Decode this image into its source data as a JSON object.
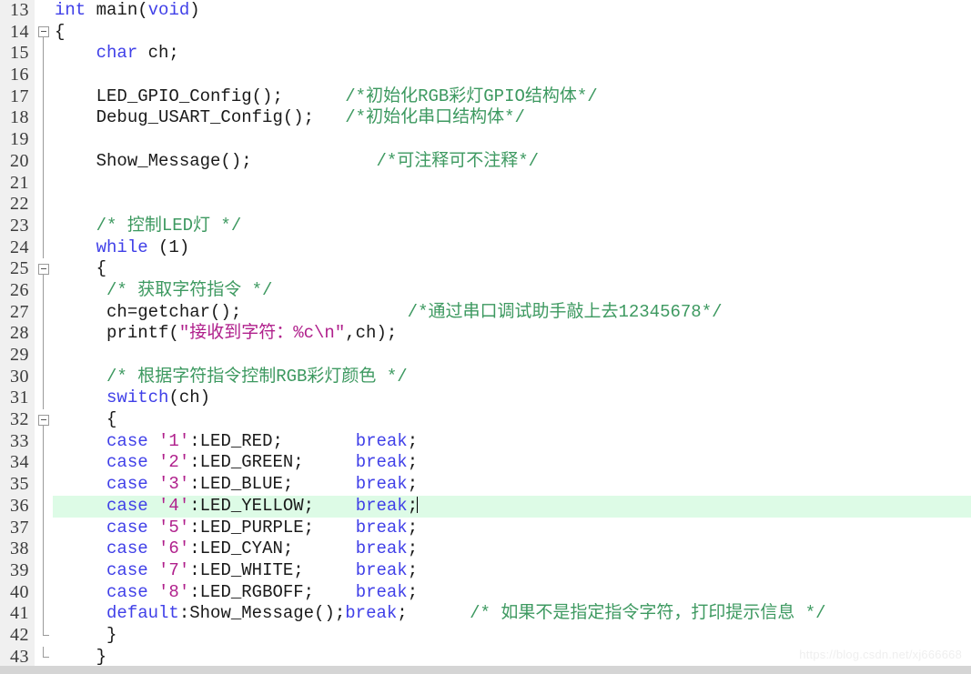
{
  "editor": {
    "first_line_number": 13,
    "last_line_number": 43,
    "current_line": 36,
    "gutter_background": "#f0f0f0",
    "current_line_highlight": "#ddfbe6",
    "colors": {
      "keyword": "#4040e8",
      "comment": "#3d9960",
      "string": "#b0208c",
      "plain": "#1a1a1a",
      "line_number": "#3b3b3b"
    },
    "watermark": "https://blog.csdn.net/xj666668",
    "lines": [
      {
        "n": "13",
        "indent": 0,
        "fold": "none",
        "tokens": [
          {
            "t": "kw",
            "v": "int"
          },
          {
            "t": "plain",
            "v": " main"
          },
          {
            "t": "plain",
            "v": "("
          },
          {
            "t": "kw",
            "v": "void"
          },
          {
            "t": "plain",
            "v": ")"
          }
        ]
      },
      {
        "n": "14",
        "indent": 0,
        "fold": "box",
        "tokens": [
          {
            "t": "plain",
            "v": "{"
          }
        ]
      },
      {
        "n": "15",
        "indent": 0,
        "fold": "line",
        "tokens": [
          {
            "t": "plain",
            "v": "    "
          },
          {
            "t": "kw",
            "v": "char"
          },
          {
            "t": "plain",
            "v": " ch;"
          }
        ]
      },
      {
        "n": "16",
        "indent": 0,
        "fold": "line",
        "tokens": []
      },
      {
        "n": "17",
        "indent": 0,
        "fold": "line",
        "tokens": [
          {
            "t": "plain",
            "v": "    LED_GPIO_Config();      "
          },
          {
            "t": "cmt",
            "v": "/*初始化RGB彩灯GPIO结构体*/"
          }
        ]
      },
      {
        "n": "18",
        "indent": 0,
        "fold": "line",
        "tokens": [
          {
            "t": "plain",
            "v": "    Debug_USART_Config();   "
          },
          {
            "t": "cmt",
            "v": "/*初始化串口结构体*/"
          }
        ]
      },
      {
        "n": "19",
        "indent": 0,
        "fold": "line",
        "tokens": []
      },
      {
        "n": "20",
        "indent": 0,
        "fold": "line",
        "tokens": [
          {
            "t": "plain",
            "v": "    Show_Message();            "
          },
          {
            "t": "cmt",
            "v": "/*可注释可不注释*/"
          }
        ]
      },
      {
        "n": "21",
        "indent": 0,
        "fold": "line",
        "tokens": []
      },
      {
        "n": "22",
        "indent": 0,
        "fold": "line",
        "tokens": []
      },
      {
        "n": "23",
        "indent": 0,
        "fold": "line",
        "tokens": [
          {
            "t": "plain",
            "v": "    "
          },
          {
            "t": "cmt",
            "v": "/* 控制LED灯 */"
          }
        ]
      },
      {
        "n": "24",
        "indent": 0,
        "fold": "line",
        "tokens": [
          {
            "t": "plain",
            "v": "    "
          },
          {
            "t": "kw",
            "v": "while"
          },
          {
            "t": "plain",
            "v": " (1)"
          }
        ]
      },
      {
        "n": "25",
        "indent": 0,
        "fold": "box",
        "tokens": [
          {
            "t": "plain",
            "v": "    {"
          }
        ]
      },
      {
        "n": "26",
        "indent": 0,
        "fold": "line",
        "tokens": [
          {
            "t": "plain",
            "v": "     "
          },
          {
            "t": "cmt",
            "v": "/* 获取字符指令 */"
          }
        ]
      },
      {
        "n": "27",
        "indent": 0,
        "fold": "line",
        "tokens": [
          {
            "t": "plain",
            "v": "     ch=getchar();                "
          },
          {
            "t": "cmt",
            "v": "/*通过串口调试助手敲上去12345678*/"
          }
        ]
      },
      {
        "n": "28",
        "indent": 0,
        "fold": "line",
        "tokens": [
          {
            "t": "plain",
            "v": "     printf("
          },
          {
            "t": "str",
            "v": "\"接收到字符：%c\\n\""
          },
          {
            "t": "plain",
            "v": ",ch);"
          }
        ]
      },
      {
        "n": "29",
        "indent": 0,
        "fold": "line",
        "tokens": []
      },
      {
        "n": "30",
        "indent": 0,
        "fold": "line",
        "tokens": [
          {
            "t": "plain",
            "v": "     "
          },
          {
            "t": "cmt",
            "v": "/* 根据字符指令控制RGB彩灯颜色 */"
          }
        ]
      },
      {
        "n": "31",
        "indent": 0,
        "fold": "line",
        "tokens": [
          {
            "t": "plain",
            "v": "     "
          },
          {
            "t": "kw",
            "v": "switch"
          },
          {
            "t": "plain",
            "v": "(ch)"
          }
        ]
      },
      {
        "n": "32",
        "indent": 0,
        "fold": "box",
        "tokens": [
          {
            "t": "plain",
            "v": "     {"
          }
        ]
      },
      {
        "n": "33",
        "indent": 0,
        "fold": "line",
        "tokens": [
          {
            "t": "plain",
            "v": "     "
          },
          {
            "t": "kw",
            "v": "case"
          },
          {
            "t": "plain",
            "v": " "
          },
          {
            "t": "str",
            "v": "'1'"
          },
          {
            "t": "plain",
            "v": ":LED_RED;       "
          },
          {
            "t": "kw",
            "v": "break"
          },
          {
            "t": "plain",
            "v": ";"
          }
        ]
      },
      {
        "n": "34",
        "indent": 0,
        "fold": "line",
        "tokens": [
          {
            "t": "plain",
            "v": "     "
          },
          {
            "t": "kw",
            "v": "case"
          },
          {
            "t": "plain",
            "v": " "
          },
          {
            "t": "str",
            "v": "'2'"
          },
          {
            "t": "plain",
            "v": ":LED_GREEN;     "
          },
          {
            "t": "kw",
            "v": "break"
          },
          {
            "t": "plain",
            "v": ";"
          }
        ]
      },
      {
        "n": "35",
        "indent": 0,
        "fold": "line",
        "tokens": [
          {
            "t": "plain",
            "v": "     "
          },
          {
            "t": "kw",
            "v": "case"
          },
          {
            "t": "plain",
            "v": " "
          },
          {
            "t": "str",
            "v": "'3'"
          },
          {
            "t": "plain",
            "v": ":LED_BLUE;      "
          },
          {
            "t": "kw",
            "v": "break"
          },
          {
            "t": "plain",
            "v": ";"
          }
        ]
      },
      {
        "n": "36",
        "indent": 0,
        "fold": "line",
        "current": true,
        "caret": true,
        "tokens": [
          {
            "t": "plain",
            "v": "     "
          },
          {
            "t": "kw",
            "v": "case"
          },
          {
            "t": "plain",
            "v": " "
          },
          {
            "t": "str",
            "v": "'4'"
          },
          {
            "t": "plain",
            "v": ":LED_YELLOW;    "
          },
          {
            "t": "kw",
            "v": "break"
          },
          {
            "t": "plain",
            "v": ";"
          }
        ]
      },
      {
        "n": "37",
        "indent": 0,
        "fold": "line",
        "tokens": [
          {
            "t": "plain",
            "v": "     "
          },
          {
            "t": "kw",
            "v": "case"
          },
          {
            "t": "plain",
            "v": " "
          },
          {
            "t": "str",
            "v": "'5'"
          },
          {
            "t": "plain",
            "v": ":LED_PURPLE;    "
          },
          {
            "t": "kw",
            "v": "break"
          },
          {
            "t": "plain",
            "v": ";"
          }
        ]
      },
      {
        "n": "38",
        "indent": 0,
        "fold": "line",
        "tokens": [
          {
            "t": "plain",
            "v": "     "
          },
          {
            "t": "kw",
            "v": "case"
          },
          {
            "t": "plain",
            "v": " "
          },
          {
            "t": "str",
            "v": "'6'"
          },
          {
            "t": "plain",
            "v": ":LED_CYAN;      "
          },
          {
            "t": "kw",
            "v": "break"
          },
          {
            "t": "plain",
            "v": ";"
          }
        ]
      },
      {
        "n": "39",
        "indent": 0,
        "fold": "line",
        "tokens": [
          {
            "t": "plain",
            "v": "     "
          },
          {
            "t": "kw",
            "v": "case"
          },
          {
            "t": "plain",
            "v": " "
          },
          {
            "t": "str",
            "v": "'7'"
          },
          {
            "t": "plain",
            "v": ":LED_WHITE;     "
          },
          {
            "t": "kw",
            "v": "break"
          },
          {
            "t": "plain",
            "v": ";"
          }
        ]
      },
      {
        "n": "40",
        "indent": 0,
        "fold": "line",
        "tokens": [
          {
            "t": "plain",
            "v": "     "
          },
          {
            "t": "kw",
            "v": "case"
          },
          {
            "t": "plain",
            "v": " "
          },
          {
            "t": "str",
            "v": "'8'"
          },
          {
            "t": "plain",
            "v": ":LED_RGBOFF;    "
          },
          {
            "t": "kw",
            "v": "break"
          },
          {
            "t": "plain",
            "v": ";"
          }
        ]
      },
      {
        "n": "41",
        "indent": 0,
        "fold": "line",
        "tokens": [
          {
            "t": "plain",
            "v": "     "
          },
          {
            "t": "kw",
            "v": "default"
          },
          {
            "t": "plain",
            "v": ":Show_Message();"
          },
          {
            "t": "kw",
            "v": "break"
          },
          {
            "t": "plain",
            "v": ";      "
          },
          {
            "t": "cmt",
            "v": "/* 如果不是指定指令字符，打印提示信息 */"
          }
        ]
      },
      {
        "n": "42",
        "indent": 0,
        "fold": "end",
        "tokens": [
          {
            "t": "plain",
            "v": "     }"
          }
        ]
      },
      {
        "n": "43",
        "indent": 0,
        "fold": "end",
        "tokens": [
          {
            "t": "plain",
            "v": "    }"
          }
        ]
      }
    ]
  }
}
